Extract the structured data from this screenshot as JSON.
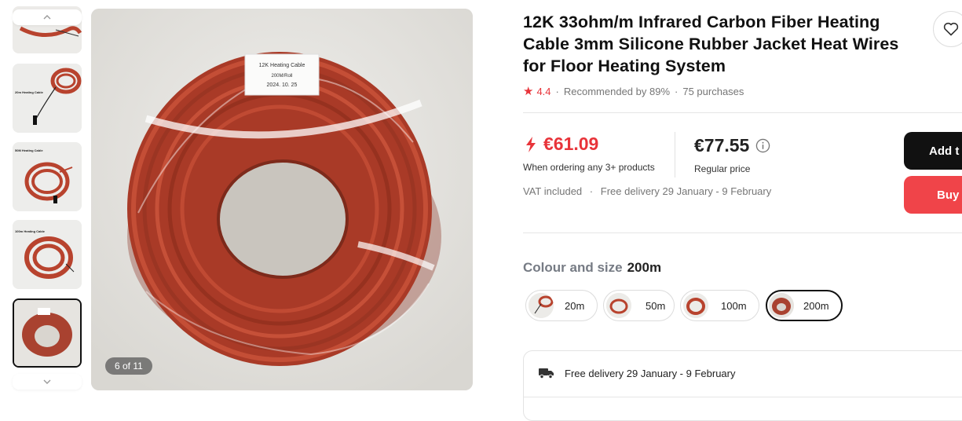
{
  "gallery": {
    "thumbnails": [
      {
        "name": "thumb-1",
        "caption": ""
      },
      {
        "name": "thumb-2",
        "caption": "20m Heating Cable"
      },
      {
        "name": "thumb-3",
        "caption": "50M Heating Cable"
      },
      {
        "name": "thumb-4",
        "caption": "100m Heating Cable"
      },
      {
        "name": "thumb-5",
        "caption": ""
      }
    ],
    "counter": "6 of 11",
    "label_lines": [
      "12K  Heating Cable",
      "200M/Roll",
      "2024. 10. 25"
    ]
  },
  "product": {
    "title": "12K 33ohm/m Infrared Carbon Fiber Heating Cable 3mm Silicone Rubber Jacket Heat Wires for Floor Heating System",
    "rating": "4.4",
    "recommended": "Recommended by 89%",
    "purchases": "75 purchases"
  },
  "pricing": {
    "promo_price": "€61.09",
    "promo_note": "When ordering any 3+ products",
    "regular_price": "€77.55",
    "regular_note": "Regular price",
    "vat": "VAT included",
    "delivery": "Free delivery 29 January - 9 February"
  },
  "actions": {
    "add_label": "Add t",
    "buy_label": "Buy"
  },
  "variants": {
    "label": "Colour and size",
    "selected": "200m",
    "options": [
      "20m",
      "50m",
      "100m",
      "200m"
    ]
  },
  "delivery_box": {
    "text": "Free delivery 29 January - 9 February"
  },
  "colors": {
    "accent_red": "#e8343a",
    "buy_red": "#f04449",
    "cable": "#b8432e"
  }
}
